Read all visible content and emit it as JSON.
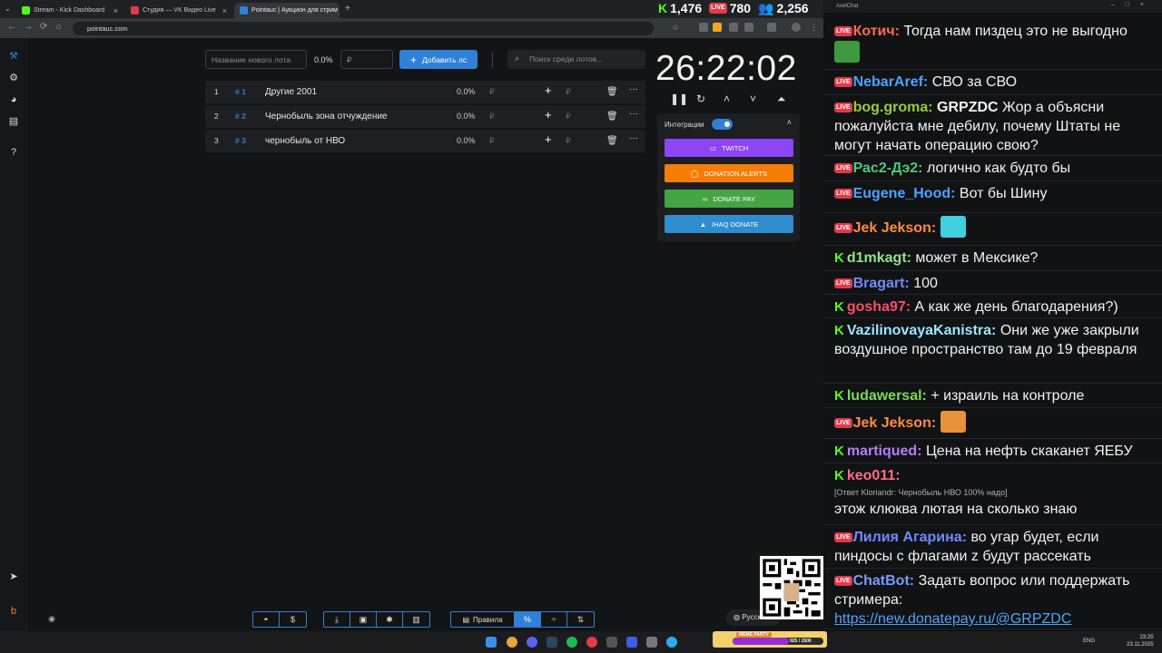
{
  "browser": {
    "tabs": [
      {
        "label": "Stream - Kick Dashboard",
        "color": "#53fc18"
      },
      {
        "label": "Студия — VK Видео Live",
        "color": "#e03b4a"
      },
      {
        "label": "Pointauc | Аукцион для стрим",
        "color": "#2f80d6"
      }
    ],
    "url": "pointauc.com"
  },
  "stream_stats": {
    "kick_viewers": "1,476",
    "vk_viewers": "780",
    "total_viewers": "2,256"
  },
  "auction": {
    "new_lot_placeholder": "Название нового лота",
    "percent": "0.0%",
    "currency_placeholder": "₽",
    "add_button": "Добавить лс",
    "search_placeholder": "Поиск среди лотов...",
    "lots": [
      {
        "num": "1",
        "id": "# 1",
        "name": "Другие 2001",
        "pct": "0.0%",
        "cur": "₽"
      },
      {
        "num": "2",
        "id": "# 2",
        "name": "Чернобыль зона отчуждение",
        "pct": "0.0%",
        "cur": "₽"
      },
      {
        "num": "3",
        "id": "# 3",
        "name": "чернобыль от НВО",
        "pct": "0.0%",
        "cur": "₽"
      }
    ],
    "timer": "26:22:02",
    "integrations": {
      "label": "Интеграции",
      "enabled": true,
      "buttons": [
        {
          "label": "TWITCH",
          "color": "#8c45f7"
        },
        {
          "label": "DONATION ALERTS",
          "color": "#f57d07"
        },
        {
          "label": "DONATE PAY",
          "color": "#45a544"
        },
        {
          "label": "IHAQ DONATE",
          "color": "#2e8ccf"
        }
      ]
    },
    "bottom": {
      "rules_label": "Правила",
      "language": "Русский"
    }
  },
  "meme_party": {
    "label": "MEME PARTY",
    "progress_text": "925 / 1500",
    "progress": 0.617
  },
  "taskbar": {
    "lang": "ENG",
    "time": "23:25",
    "date": "23.11.2025"
  },
  "chat": {
    "title": "AxelChat",
    "messages": [
      {
        "platform": "vk",
        "nick": "Котич:",
        "nick_color": "#ff6b4a",
        "text": "Тогда нам пиздец это не выгодно",
        "emote": "#3c9a3c"
      },
      {
        "platform": "vk",
        "nick": "NebarAref:",
        "nick_color": "#4aa3ff",
        "text": "СВО за СВО"
      },
      {
        "platform": "vk",
        "nick": "bog.groma:",
        "nick_color": "#9acd32",
        "bold_prefix": "GRPZDC",
        "text": "Жор а объясни пожалуйста мне дебилу, почему Штаты не могут начать операцию свою?"
      },
      {
        "platform": "vk",
        "nick": "Рас2-Дэ2:",
        "nick_color": "#50c878",
        "text": "логично как будто бы"
      },
      {
        "platform": "vk",
        "nick": "Eugene_Hood:",
        "nick_color": "#4aa3ff",
        "text": "Вот бы Шину"
      },
      {
        "platform": "vk",
        "nick": "Jek Jekson:",
        "nick_color": "#ff8c42",
        "text": "",
        "emote": "#3fd0e0"
      },
      {
        "platform": "kick",
        "nick": "d1mkagt:",
        "nick_color": "#8fe38f",
        "text": "может в Мексике?"
      },
      {
        "platform": "vk",
        "nick": "Bragart:",
        "nick_color": "#6f8cff",
        "text": "100"
      },
      {
        "platform": "kick",
        "nick": "gosha97:",
        "nick_color": "#ff4d6d",
        "text": "А как же день благодарения?)"
      },
      {
        "platform": "kick",
        "nick": "VazilinovayaKanistra:",
        "nick_color": "#9ee6ff",
        "text": "Они же уже закрыли воздушное пространство там до 19 февраля"
      },
      {
        "platform": "kick",
        "nick": "ludawersal:",
        "nick_color": "#7cd957",
        "text": "+ израиль на контроле"
      },
      {
        "platform": "vk",
        "nick": "Jek Jekson:",
        "nick_color": "#ff8c42",
        "text": "",
        "emote": "#e8903a"
      },
      {
        "platform": "kick",
        "nick": "martiqued:",
        "nick_color": "#b77cff",
        "text": "Цена на нефть скаканет ЯЕБУ"
      },
      {
        "platform": "kick",
        "nick": "keo011:",
        "nick_color": "#ff6b8a",
        "reply": "[Ответ Kloriandr: Чернобыль НВО 100% надо]",
        "text": "этож клюква лютая на сколько знаю"
      },
      {
        "platform": "vk",
        "nick": "Лилия Агарина:",
        "nick_color": "#6f8cff",
        "text": "во угар будет, если пиндосы с флагами z будут рассекать"
      },
      {
        "platform": "vk",
        "nick": "ChatBot:",
        "nick_color": "#7a9bff",
        "text": "Задать вопрос или поддержать стримера:",
        "link": "https://new.donatepay.ru/@GRPZDC"
      }
    ]
  }
}
